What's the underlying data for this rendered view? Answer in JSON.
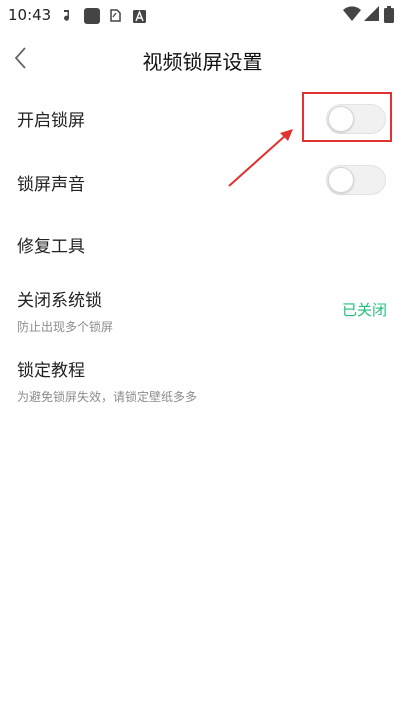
{
  "status_bar": {
    "time": "10:43",
    "icons": [
      "music-note-icon",
      "app-square-icon",
      "notification-icon",
      "a-badge-icon"
    ],
    "right_icons": [
      "wifi-icon",
      "signal-icon",
      "battery-icon"
    ]
  },
  "header": {
    "title": "视频锁屏设置",
    "back_icon": "chevron-left-icon"
  },
  "settings": {
    "enable_lock": {
      "label": "开启锁屏",
      "on": false
    },
    "lock_sound": {
      "label": "锁屏声音",
      "on": false
    },
    "repair_tools": {
      "label": "修复工具"
    },
    "close_system_lock": {
      "label": "关闭系统锁",
      "sub": "防止出现多个锁屏",
      "value": "已关闭"
    },
    "lock_tutorial": {
      "label": "锁定教程",
      "sub": "为避免锁屏失效，请锁定壁纸多多"
    }
  },
  "colors": {
    "accent_green": "#21c07a",
    "annotation_red": "#e0322f"
  }
}
